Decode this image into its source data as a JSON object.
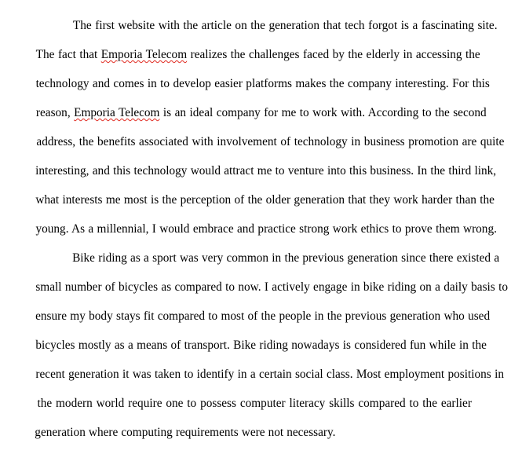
{
  "document": {
    "paragraphs": [
      {
        "lines": [
          [
            "The first website with the article on the generation that tech forgot is a fascinating site."
          ],
          [
            "The fact that ",
            {
              "t": "Emporia Telecom",
              "sq": true
            },
            " realizes the challenges faced by the elderly in accessing the"
          ],
          [
            "technology and comes in to develop easier platforms makes the company interesting. For this"
          ],
          [
            "reason, ",
            {
              "t": "Emporia Telecom",
              "sq": true
            },
            " is an ideal company for me to work with. According to the second"
          ],
          [
            "address, the benefits associated with involvement of technology in business promotion are quite"
          ],
          [
            "interesting, and this technology would attract me to venture into this business. In the third link,"
          ],
          [
            "what interests me most is the perception of the older generation that they work harder than the"
          ],
          [
            "young. As a millennial, I would embrace and practice strong work ethics to prove them wrong."
          ]
        ]
      },
      {
        "lines": [
          [
            "Bike riding as a sport was very common in the previous generation since there existed a"
          ],
          [
            "small number of bicycles as compared to now. I actively engage in bike riding on a daily basis to"
          ],
          [
            "ensure my body stays fit compared to most of the people in the previous generation who used"
          ],
          [
            "bicycles mostly as a means of transport. Bike riding nowadays is considered fun while in the"
          ],
          [
            "recent generation it was taken to identify in a certain social class. Most employment positions in"
          ],
          [
            "the modern world require one to possess computer literacy skills compared to the earlier"
          ],
          [
            "generation where computing requirements were not necessary."
          ]
        ]
      }
    ]
  }
}
